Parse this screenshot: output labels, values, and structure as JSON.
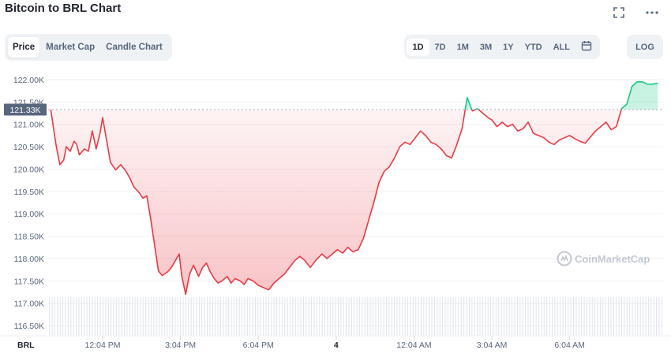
{
  "header": {
    "title": "Bitcoin to BRL Chart"
  },
  "icons": {
    "fullscreen": "fullscreen-icon",
    "more": "more-icon",
    "calendar": "calendar-icon"
  },
  "tabs": [
    {
      "label": "Price",
      "active": true
    },
    {
      "label": "Market Cap",
      "active": false
    },
    {
      "label": "Candle Chart",
      "active": false
    }
  ],
  "ranges": [
    {
      "label": "1D",
      "active": true
    },
    {
      "label": "7D",
      "active": false
    },
    {
      "label": "1M",
      "active": false
    },
    {
      "label": "3M",
      "active": false
    },
    {
      "label": "1Y",
      "active": false
    },
    {
      "label": "YTD",
      "active": false
    },
    {
      "label": "ALL",
      "active": false
    }
  ],
  "log_label": "LOG",
  "watermark": "CoinMarketCap",
  "colors": {
    "down": "#ea3943",
    "up": "#16c784",
    "tag_bg": "#58667e"
  },
  "chart_data": {
    "type": "line",
    "ylim": [
      116.5,
      122.0
    ],
    "yticks": [
      "122.00K",
      "121.50K",
      "121.00K",
      "120.50K",
      "120.00K",
      "119.50K",
      "119.00K",
      "118.50K",
      "118.00K",
      "117.50K",
      "117.00K",
      "116.50K"
    ],
    "currency_label": "BRL",
    "current_price_label": "121.33K",
    "reference_price": 121.33,
    "xtick_labels": [
      "12:04 PM",
      "3:04 PM",
      "6:04 PM",
      "4",
      "12:04 AM",
      "3:04 AM",
      "6:04 AM"
    ],
    "xtick_hours": [
      2,
      5,
      8,
      11,
      14,
      17,
      20
    ],
    "x_range_hours": [
      -0.1,
      23.6
    ],
    "series": [
      {
        "hours": [
          0,
          0.2,
          0.35,
          0.5,
          0.6,
          0.75,
          0.9,
          1.0,
          1.1,
          1.3,
          1.45,
          1.6,
          1.75,
          1.9,
          2.0,
          2.15,
          2.3,
          2.5,
          2.7,
          2.9,
          3.05,
          3.2,
          3.4,
          3.55,
          3.7,
          3.85,
          4.0,
          4.15,
          4.3,
          4.5,
          4.65,
          4.8,
          4.95,
          5.05,
          5.2,
          5.35,
          5.5,
          5.7,
          5.85,
          6.0,
          6.15,
          6.3,
          6.45,
          6.6,
          6.8,
          6.95,
          7.1,
          7.3,
          7.45,
          7.6,
          7.8,
          8.0,
          8.2,
          8.4,
          8.6,
          8.8,
          9.0,
          9.2,
          9.4,
          9.6,
          9.8,
          10.0,
          10.2,
          10.45,
          10.65,
          10.85,
          11.05,
          11.25,
          11.45,
          11.65,
          11.85,
          12.05,
          12.25,
          12.45,
          12.65,
          12.85,
          13.05,
          13.25,
          13.45,
          13.65,
          13.85,
          14.05,
          14.25,
          14.45,
          14.65,
          14.85,
          15.05,
          15.25,
          15.45,
          15.65,
          15.85,
          16.05,
          16.25,
          16.45,
          16.65,
          16.85,
          17.0,
          17.2,
          17.4,
          17.6,
          17.8,
          18.0,
          18.2,
          18.4,
          18.6,
          18.8,
          19.0,
          19.2,
          19.4,
          19.6,
          19.8,
          20.0,
          20.2,
          20.4,
          20.6,
          20.8,
          21.0,
          21.2,
          21.4,
          21.6,
          21.8,
          22.0,
          22.2,
          22.4,
          22.6,
          22.8,
          23.0,
          23.2,
          23.4
        ],
        "values": [
          121.33,
          120.55,
          120.1,
          120.2,
          120.5,
          120.4,
          120.62,
          120.55,
          120.32,
          120.45,
          120.4,
          120.85,
          120.45,
          120.8,
          121.15,
          120.65,
          120.15,
          119.98,
          120.1,
          119.95,
          119.8,
          119.6,
          119.48,
          119.35,
          119.4,
          118.9,
          118.3,
          117.72,
          117.62,
          117.7,
          117.8,
          117.95,
          118.1,
          117.6,
          117.2,
          117.65,
          117.85,
          117.6,
          117.8,
          117.9,
          117.7,
          117.55,
          117.45,
          117.5,
          117.6,
          117.45,
          117.55,
          117.5,
          117.42,
          117.55,
          117.5,
          117.4,
          117.35,
          117.3,
          117.45,
          117.55,
          117.65,
          117.8,
          117.95,
          118.05,
          117.95,
          117.8,
          117.95,
          118.1,
          118.0,
          118.1,
          118.2,
          118.12,
          118.25,
          118.15,
          118.2,
          118.45,
          118.85,
          119.25,
          119.7,
          119.95,
          120.05,
          120.25,
          120.5,
          120.6,
          120.55,
          120.7,
          120.85,
          120.75,
          120.6,
          120.55,
          120.45,
          120.3,
          120.25,
          120.55,
          120.9,
          121.6,
          121.3,
          121.35,
          121.25,
          121.15,
          121.1,
          120.95,
          121.05,
          120.95,
          121.0,
          120.85,
          120.9,
          121.05,
          120.8,
          120.75,
          120.7,
          120.6,
          120.55,
          120.65,
          120.7,
          120.75,
          120.68,
          120.62,
          120.58,
          120.72,
          120.85,
          120.95,
          121.05,
          120.88,
          120.95,
          121.35,
          121.45,
          121.85,
          121.95,
          121.95,
          121.9,
          121.9,
          121.92
        ],
        "color_below_reference": "#ea3943",
        "color_above_reference": "#16c784"
      }
    ],
    "volume_bars": 230,
    "grid": true
  }
}
